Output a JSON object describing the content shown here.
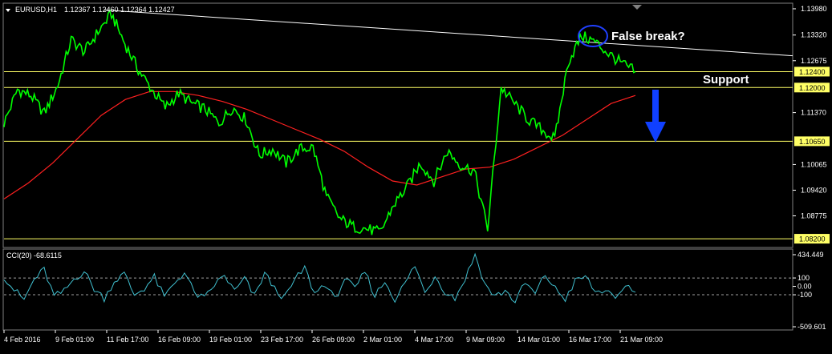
{
  "header": {
    "symbol_label": "EURUSD,H1",
    "ohlc_values": "1.12367 1.12460 1.12364 1.12427"
  },
  "indicator": {
    "label": "CCI(20) -68.6115"
  },
  "annotations": {
    "false_break": "False break?",
    "support": "Support"
  },
  "colors": {
    "price_line": "#00ff00",
    "moving_average": "#ff2020",
    "level_lines": "#ffff66",
    "trend_line": "#ffffff",
    "cci_line": "#40c0d0",
    "arrow": "#1040ff",
    "circle": "#2040ff"
  },
  "chart_data": [
    {
      "type": "line",
      "title": "EURUSD,H1",
      "x_tick_labels": [
        "4 Feb 2016",
        "9 Feb 01:00",
        "11 Feb 17:00",
        "16 Feb 09:00",
        "19 Feb 01:00",
        "23 Feb 17:00",
        "26 Feb 09:00",
        "2 Mar 01:00",
        "4 Mar 17:00",
        "9 Mar 09:00",
        "14 Mar 01:00",
        "16 Mar 17:00",
        "21 Mar 09:00"
      ],
      "y_tick_labels": [
        "1.13980",
        "1.13320",
        "1.12675",
        "1.11370",
        "1.10065",
        "1.09420",
        "1.08775"
      ],
      "ylim": [
        1.08,
        1.141
      ],
      "highlighted_levels": [
        {
          "label": "1.12400",
          "value": 1.124
        },
        {
          "label": "1.12000",
          "value": 1.12
        },
        {
          "label": "1.10650",
          "value": 1.1065
        },
        {
          "label": "1.08200",
          "value": 1.082
        }
      ],
      "trend_line": {
        "start": 1.1395,
        "end": 1.128
      },
      "series": [
        {
          "values": [
            1.111,
            1.1195,
            1.118,
            1.1135,
            1.1205,
            1.132,
            1.129,
            1.134,
            1.1385,
            1.131,
            1.1245,
            1.1195,
            1.115,
            1.1185,
            1.116,
            1.1145,
            1.111,
            1.115,
            1.112,
            1.103,
            1.1045,
            1.101,
            1.1045,
            1.105,
            1.0925,
            1.087,
            1.085,
            1.0845,
            1.0835,
            1.0905,
            1.095,
            1.101,
            1.0965,
            1.104,
            1.1005,
            1.099,
            1.0845,
            1.12,
            1.116,
            1.112,
            1.1095,
            1.107,
            1.1265,
            1.133,
            1.1315,
            1.1285,
            1.126,
            1.124
          ]
        },
        {
          "values": [
            1.092,
            1.096,
            1.101,
            1.107,
            1.113,
            1.117,
            1.119,
            1.119,
            1.118,
            1.1165,
            1.1145,
            1.112,
            1.1095,
            1.107,
            1.104,
            1.1,
            1.0965,
            1.0955,
            1.0975,
            1.0995,
            1.1,
            1.102,
            1.105,
            1.108,
            1.112,
            1.116,
            1.118
          ]
        }
      ]
    },
    {
      "type": "line",
      "title": "CCI(20) -68.6115",
      "y_tick_labels": [
        "434.449",
        "100",
        "0.00",
        "-100",
        "-509.601"
      ],
      "ylim": [
        -509.601,
        434.449
      ],
      "reference_levels": [
        100,
        -100
      ],
      "series": [
        {
          "values": [
            120,
            -40,
            -160,
            80,
            200,
            -120,
            -60,
            90,
            180,
            -30,
            -140,
            60,
            150,
            -100,
            -20,
            110,
            -130,
            40,
            170,
            -80,
            -150,
            20,
            130,
            -60,
            90,
            -120,
            160,
            -30,
            -140,
            70,
            220,
            -90,
            40,
            -160,
            100,
            -40,
            180,
            -110,
            60,
            -150,
            30,
            250,
            -80,
            130,
            -60,
            -140,
            90,
            380,
            20,
            -120,
            -50,
            -180,
            40,
            -90,
            140,
            -30,
            -150,
            60,
            120,
            -70,
            -40,
            -180,
            30,
            -69
          ]
        }
      ]
    }
  ]
}
